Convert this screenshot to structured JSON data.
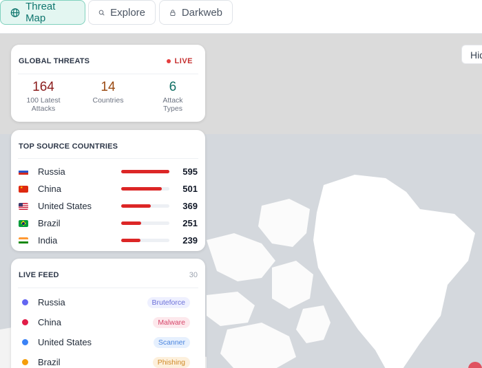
{
  "nav": {
    "tabs": [
      {
        "label": "Threat Map",
        "icon": "globe-icon",
        "active": true
      },
      {
        "label": "Explore",
        "icon": "search-icon",
        "active": false
      },
      {
        "label": "Darkweb",
        "icon": "lock-icon",
        "active": false
      }
    ]
  },
  "map": {
    "hide_label": "Hid"
  },
  "global": {
    "title": "GLOBAL THREATS",
    "live_label": "LIVE",
    "stats": [
      {
        "value": "164",
        "label_line1": "100 Latest",
        "label_line2": "Attacks",
        "color": "#8b1c1c"
      },
      {
        "value": "14",
        "label_line1": "Countries",
        "label_line2": "",
        "color": "#9a4a12"
      },
      {
        "value": "6",
        "label_line1": "Attack",
        "label_line2": "Types",
        "color": "#0f6e63"
      }
    ]
  },
  "sources": {
    "title": "TOP SOURCE COUNTRIES",
    "rows": [
      {
        "country": "Russia",
        "flag": "russia",
        "count": "595",
        "fraction": 1.0
      },
      {
        "country": "China",
        "flag": "china",
        "count": "501",
        "fraction": 0.84
      },
      {
        "country": "United States",
        "flag": "usa",
        "count": "369",
        "fraction": 0.62
      },
      {
        "country": "Brazil",
        "flag": "brazil",
        "count": "251",
        "fraction": 0.42
      },
      {
        "country": "India",
        "flag": "india",
        "count": "239",
        "fraction": 0.4
      }
    ]
  },
  "feed": {
    "title": "LIVE FEED",
    "count": "30",
    "items": [
      {
        "country": "Russia",
        "type": "Bruteforce",
        "dot": "#6366f1",
        "tag_bg": "#eef0ff",
        "tag_fg": "#6b6fd8"
      },
      {
        "country": "China",
        "type": "Malware",
        "dot": "#e11d48",
        "tag_bg": "#fde8ec",
        "tag_fg": "#d6456a"
      },
      {
        "country": "United States",
        "type": "Scanner",
        "dot": "#3b82f6",
        "tag_bg": "#e6f0fe",
        "tag_fg": "#4a84dd"
      },
      {
        "country": "Brazil",
        "type": "Phishing",
        "dot": "#f59e0b",
        "tag_bg": "#fdf0dc",
        "tag_fg": "#d08a26"
      }
    ]
  }
}
